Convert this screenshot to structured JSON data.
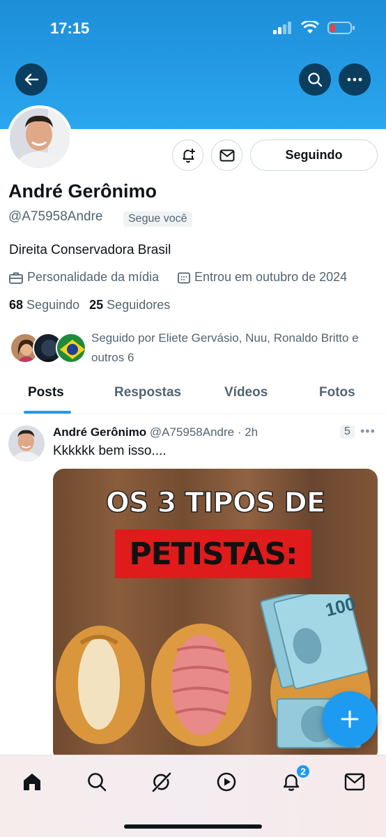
{
  "status_bar": {
    "time": "17:15"
  },
  "profile": {
    "name": "André Gerônimo",
    "handle": "@A75958Andre",
    "follows_you_badge": "Segue você",
    "bio": "Direita Conservadora Brasil",
    "category": "Personalidade da mídia",
    "joined": "Entrou em outubro de 2024",
    "following_count": "68",
    "following_label": "Seguindo",
    "followers_count": "25",
    "followers_label": "Seguidores",
    "followed_by_text": "Seguido por Eliete Gervásio, Nuu, Ronaldo Britto e outros 6",
    "follow_button_label": "Seguindo"
  },
  "tabs": [
    {
      "label": "Posts",
      "active": true
    },
    {
      "label": "Respostas",
      "active": false
    },
    {
      "label": "Vídeos",
      "active": false
    },
    {
      "label": "Fotos",
      "active": false
    }
  ],
  "post": {
    "author_name": "André Gerônimo",
    "author_handle": "@A75958Andre",
    "time": "· 2h",
    "count_badge": "5",
    "text": "Kkkkkk bem isso....",
    "media_title_line1": "OS 3 TIPOS DE",
    "media_title_line2": "PETISTAS:",
    "media_note_value": "100"
  },
  "bottom_nav": {
    "items": [
      "home-icon",
      "search-icon",
      "grok-icon",
      "video-icon",
      "notifications-icon",
      "messages-icon"
    ],
    "notification_badge": "2"
  },
  "colors": {
    "header_blue": "#2aa6ef",
    "accent": "#1d9bf0",
    "banner_red": "#e01b1b"
  }
}
